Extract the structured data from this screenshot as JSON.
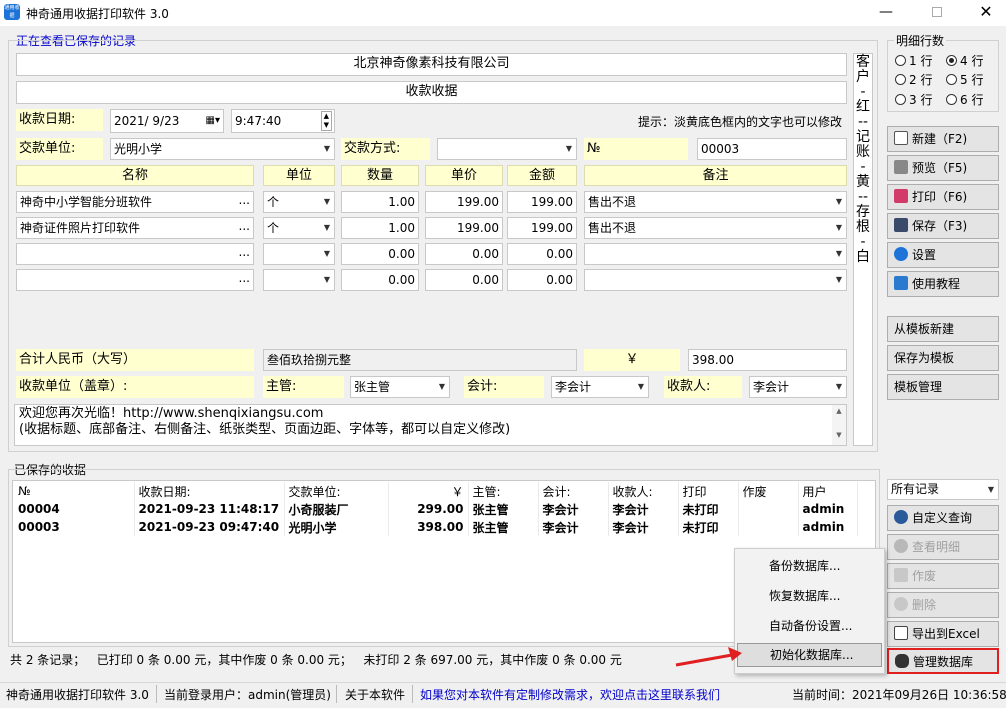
{
  "window": {
    "title": "神奇通用收据打印软件 3.0",
    "app_icon_text": "通用收据",
    "viewing_label": "正在查看已保存的记录"
  },
  "receipt": {
    "company": "北京神奇像素科技有限公司",
    "title": "收款收据",
    "date_label": "收款日期:",
    "date_value": "2021/ 9/23",
    "time_value": "9:47:40",
    "hint": "提示：淡黄底色框内的文字也可以修改",
    "payer_label": "交款单位:",
    "payer_value": "光明小学",
    "method_label": "交款方式:",
    "method_value": "",
    "no_label": "№",
    "no_value": "00003",
    "columns": [
      "名称",
      "单位",
      "数量",
      "单价",
      "金额",
      "备注"
    ],
    "rows": [
      {
        "name": "神奇中小学智能分班软件",
        "unit": "个",
        "qty": "1.00",
        "price": "199.00",
        "amount": "199.00",
        "remark": "售出不退"
      },
      {
        "name": "神奇证件照片打印软件",
        "unit": "个",
        "qty": "1.00",
        "price": "199.00",
        "amount": "199.00",
        "remark": "售出不退"
      },
      {
        "name": "",
        "unit": "",
        "qty": "0.00",
        "price": "0.00",
        "amount": "0.00",
        "remark": ""
      },
      {
        "name": "",
        "unit": "",
        "qty": "0.00",
        "price": "0.00",
        "amount": "0.00",
        "remark": ""
      }
    ],
    "total_cn_label": "合计人民币（大写）",
    "total_cn_value": "叁佰玖拾捌元整",
    "yen_label": "￥",
    "total_value": "398.00",
    "stamp_label": "收款单位（盖章）:",
    "manager_label": "主管:",
    "manager_value": "张主管",
    "accountant_label": "会计:",
    "accountant_value": "李会计",
    "cashier_label": "收款人:",
    "cashier_value": "李会计",
    "note_line1": "欢迎您再次光临！http://www.shenqixiangsu.com",
    "note_line2": "(收据标题、底部备注、右侧备注、纸张类型、页面边距、字体等，都可以自定义修改)",
    "side_note": [
      "客",
      "户",
      "-",
      "红",
      "--",
      "记",
      "账",
      "-",
      "黄",
      "--",
      "存",
      "根",
      "-",
      "白"
    ]
  },
  "right_panel": {
    "rows_label": "明细行数",
    "row_options": [
      "1 行",
      "4 行",
      "2 行",
      "5 行",
      "3 行",
      "6 行"
    ],
    "selected_rows": "4 行",
    "buttons": {
      "new": "新建（F2)",
      "preview": "预览（F5)",
      "print": "打印（F6)",
      "save": "保存（F3)",
      "settings": "设置",
      "tutorial": "使用教程",
      "from_template": "从模板新建",
      "save_template": "保存为模板",
      "manage_template": "模板管理"
    }
  },
  "saved": {
    "label": "已保存的收据",
    "filter_value": "所有记录",
    "headers": [
      "№",
      "收款日期:",
      "交款单位:",
      "￥",
      "主管:",
      "会计:",
      "收款人:",
      "打印",
      "作废",
      "用户"
    ],
    "rows": [
      [
        "00004",
        "2021-09-23 11:48:17",
        "小奇服装厂",
        "299.00",
        "张主管",
        "李会计",
        "李会计",
        "未打印",
        "",
        "admin"
      ],
      [
        "00003",
        "2021-09-23 09:47:40",
        "光明小学",
        "398.00",
        "张主管",
        "李会计",
        "李会计",
        "未打印",
        "",
        "admin"
      ]
    ],
    "summary": "共 2 条记录；   已打印 0 条 0.00 元，其中作废 0 条 0.00 元；   未打印 2 条 697.00 元，其中作废 0 条 0.00 元",
    "buttons": {
      "custom_query": "自定义查询",
      "view_detail": "查看明细",
      "void": "作废",
      "delete": "删除",
      "export": "导出到Excel",
      "manage_db": "管理数据库"
    }
  },
  "context_menu": {
    "items": [
      "备份数据库...",
      "恢复数据库...",
      "自动备份设置...",
      "初始化数据库..."
    ]
  },
  "status_bar": {
    "app": "神奇通用收据打印软件 3.0",
    "user": "当前登录用户：admin(管理员)",
    "about": "关于本软件",
    "link": "如果您对本软件有定制修改需求，欢迎点击这里联系我们",
    "time": "当前时间：2021年09月26日 10:36:58"
  },
  "colors": {
    "field_yellow": "#ffffd0",
    "link_blue": "#0000cc",
    "highlight_red": "#e02020",
    "menu_selected": "#d8d8d8"
  }
}
